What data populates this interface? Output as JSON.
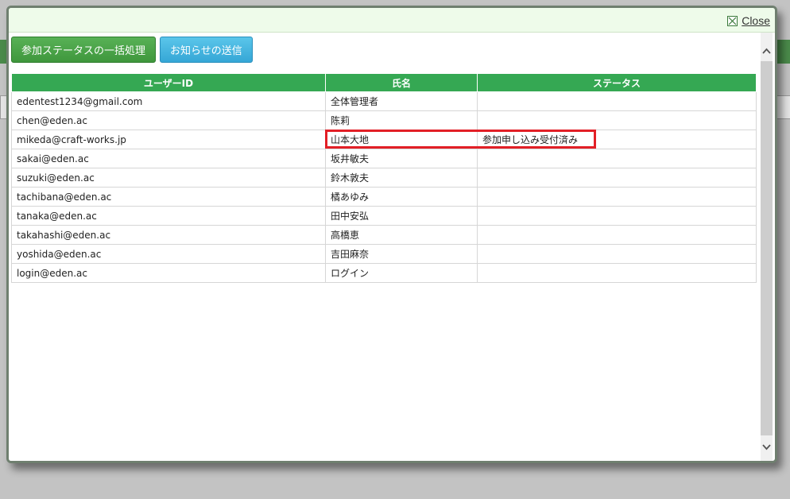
{
  "dialog": {
    "close_label": "Close"
  },
  "toolbar": {
    "bulk_status_label": "参加ステータスの一括処理",
    "send_notice_label": "お知らせの送信"
  },
  "table": {
    "headers": [
      "ユーザーID",
      "氏名",
      "ステータス"
    ],
    "rows": [
      {
        "user_id": "edentest1234@gmail.com",
        "name": "全体管理者",
        "status": ""
      },
      {
        "user_id": "chen@eden.ac",
        "name": "陈莉",
        "status": ""
      },
      {
        "user_id": "mikeda@craft-works.jp",
        "name": "山本大地",
        "status": "参加申し込み受付済み"
      },
      {
        "user_id": "sakai@eden.ac",
        "name": "坂井敏夫",
        "status": ""
      },
      {
        "user_id": "suzuki@eden.ac",
        "name": "鈴木敦夫",
        "status": ""
      },
      {
        "user_id": "tachibana@eden.ac",
        "name": "橘あゆみ",
        "status": ""
      },
      {
        "user_id": "tanaka@eden.ac",
        "name": "田中安弘",
        "status": ""
      },
      {
        "user_id": "takahashi@eden.ac",
        "name": "高橋恵",
        "status": ""
      },
      {
        "user_id": "yoshida@eden.ac",
        "name": "吉田麻奈",
        "status": ""
      },
      {
        "user_id": "login@eden.ac",
        "name": "ログイン",
        "status": ""
      }
    ]
  },
  "colors": {
    "header_green": "#35a853",
    "button_green": "#4aa548",
    "button_blue": "#3cb3e0",
    "highlight_red": "#e21f26"
  },
  "icons": {
    "close": "close-icon",
    "scroll_up": "chevron-up-icon",
    "scroll_down": "chevron-down-icon"
  }
}
